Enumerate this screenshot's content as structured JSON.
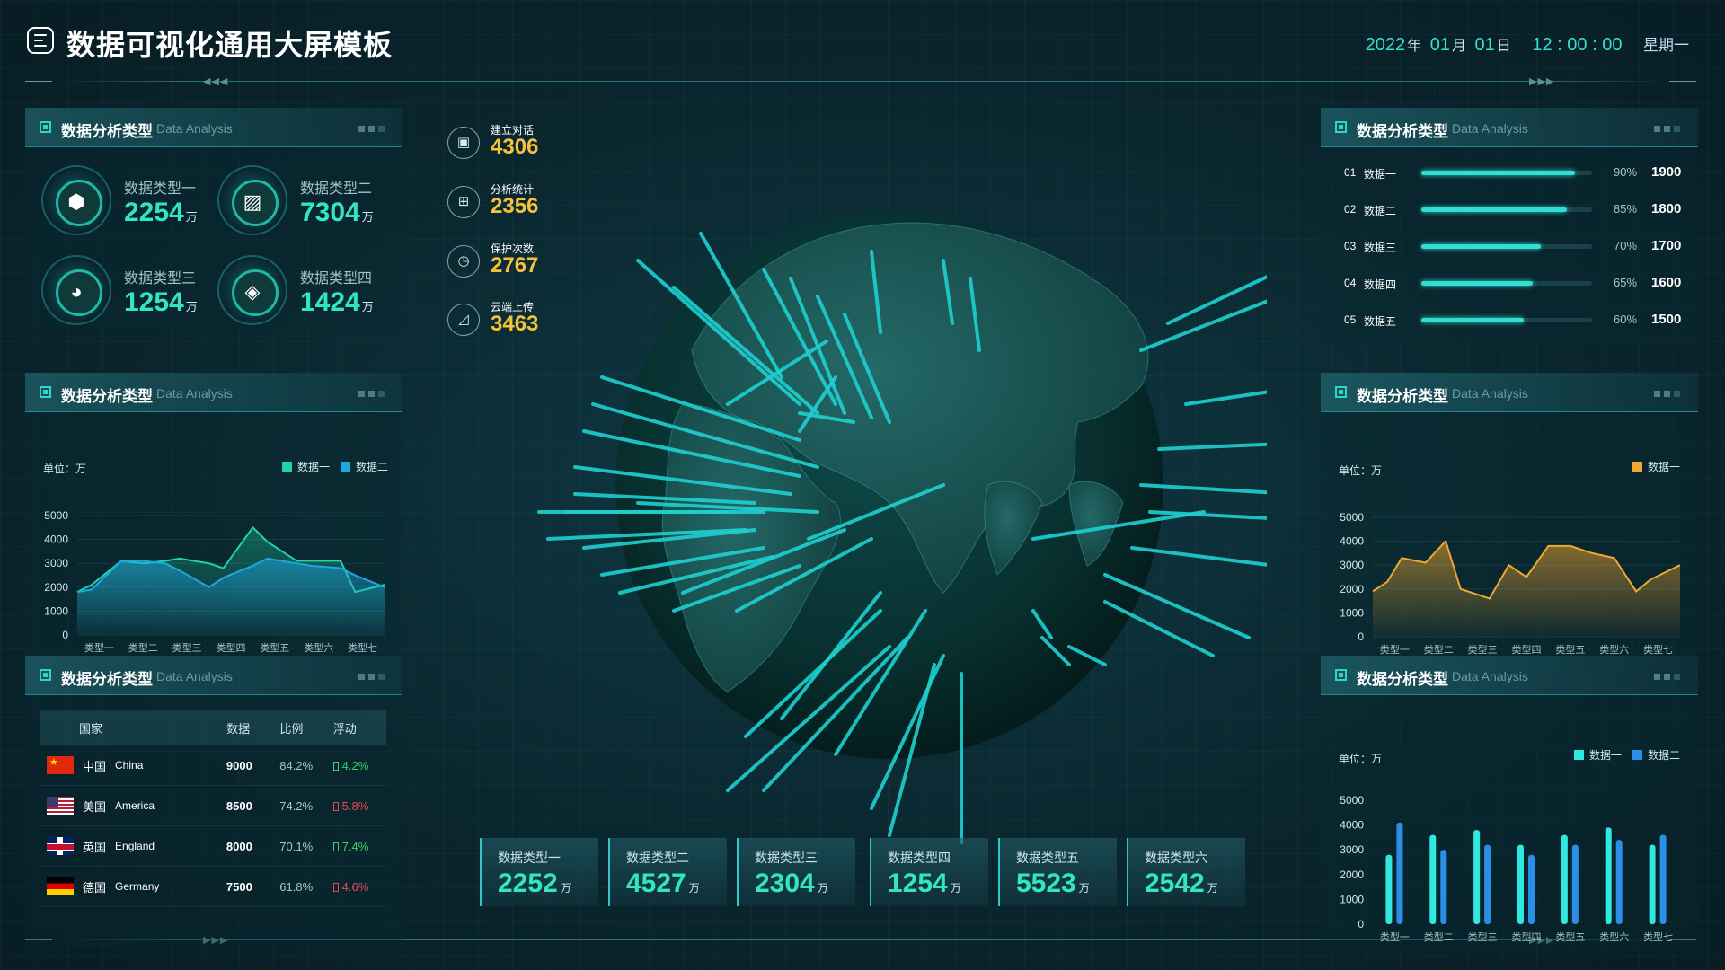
{
  "header": {
    "title": "数据可视化通用大屏模板",
    "date_year": "2022",
    "year_char": "年",
    "date_month": "01",
    "month_char": "月",
    "date_day": "01",
    "day_char": "日",
    "time": "12 : 00 : 00",
    "weekday": "星期一"
  },
  "panels": {
    "title": "数据分析类型",
    "subtitle": "Data Analysis"
  },
  "stats": [
    {
      "label": "数据类型一",
      "value": "2254",
      "unit": "万",
      "icon": "cube-icon"
    },
    {
      "label": "数据类型二",
      "value": "7304",
      "unit": "万",
      "icon": "chart-line-icon"
    },
    {
      "label": "数据类型三",
      "value": "1254",
      "unit": "万",
      "icon": "pie-chart-icon"
    },
    {
      "label": "数据类型四",
      "value": "1424",
      "unit": "万",
      "icon": "box-icon"
    }
  ],
  "left_chart": {
    "unit_label": "单位：万",
    "legend": [
      "数据一",
      "数据二"
    ]
  },
  "table": {
    "headers": [
      "国家",
      "数据",
      "比例",
      "浮动"
    ],
    "rows": [
      {
        "flag": "cn",
        "name": "中国",
        "name_en": "China",
        "data": "9000",
        "ratio": "84.2%",
        "float": "4.2%",
        "dir": "up"
      },
      {
        "flag": "us",
        "name": "美国",
        "name_en": "America",
        "data": "8500",
        "ratio": "74.2%",
        "float": "5.8%",
        "dir": "down"
      },
      {
        "flag": "uk",
        "name": "英国",
        "name_en": "England",
        "data": "8000",
        "ratio": "70.1%",
        "float": "7.4%",
        "dir": "up"
      },
      {
        "flag": "de",
        "name": "德国",
        "name_en": "Germany",
        "data": "7500",
        "ratio": "61.8%",
        "float": "4.6%",
        "dir": "down"
      }
    ]
  },
  "mini_stats": [
    {
      "label": "建立对话",
      "value": "4306",
      "icon": "monitor-icon"
    },
    {
      "label": "分析统计",
      "value": "2356",
      "icon": "chip-icon"
    },
    {
      "label": "保护次数",
      "value": "2767",
      "icon": "gauge-icon"
    },
    {
      "label": "云端上传",
      "value": "3463",
      "icon": "growth-chart-icon"
    }
  ],
  "progress": [
    {
      "index": "01",
      "name": "数据一",
      "percent": 90,
      "pct_label": "90%",
      "value": "1900"
    },
    {
      "index": "02",
      "name": "数据二",
      "percent": 85,
      "pct_label": "85%",
      "value": "1800"
    },
    {
      "index": "03",
      "name": "数据三",
      "percent": 70,
      "pct_label": "70%",
      "value": "1700"
    },
    {
      "index": "04",
      "name": "数据四",
      "percent": 65,
      "pct_label": "65%",
      "value": "1600"
    },
    {
      "index": "05",
      "name": "数据五",
      "percent": 60,
      "pct_label": "60%",
      "value": "1500"
    }
  ],
  "right_area": {
    "unit_label": "单位：万",
    "legend": [
      "数据一"
    ]
  },
  "right_bar": {
    "unit_label": "单位：万",
    "legend": [
      "数据一",
      "数据二"
    ]
  },
  "cards": [
    {
      "label": "数据类型一",
      "value": "2252",
      "unit": "万"
    },
    {
      "label": "数据类型二",
      "value": "4527",
      "unit": "万"
    },
    {
      "label": "数据类型三",
      "value": "2304",
      "unit": "万"
    },
    {
      "label": "数据类型四",
      "value": "1254",
      "unit": "万"
    },
    {
      "label": "数据类型五",
      "value": "5523",
      "unit": "万"
    },
    {
      "label": "数据类型六",
      "value": "2542",
      "unit": "万"
    }
  ],
  "colors": {
    "accent": "#2fd4c8",
    "green": "#32e6c3",
    "gold": "#f5c338",
    "series_a": "#1fd5a8",
    "series_b": "#1ea8e0",
    "bar_a": "#2fe8e0",
    "bar_b": "#2b8fe8"
  },
  "chart_data": [
    {
      "type": "area",
      "title": "数据分析类型",
      "ylabel": "单位：万",
      "categories": [
        "类型一",
        "类型二",
        "类型三",
        "类型四",
        "类型五",
        "类型六",
        "类型七"
      ],
      "ylim": [
        0,
        5000
      ],
      "yticks": [
        0,
        1000,
        2000,
        3000,
        4000,
        5000
      ],
      "x": [
        0,
        0.33,
        1,
        1.5,
        2,
        2.33,
        3,
        3.33,
        4,
        4.33,
        5,
        5.33,
        6,
        6.33,
        7
      ],
      "series": [
        {
          "name": "数据一",
          "values": [
            1800,
            2100,
            3100,
            3000,
            3100,
            3200,
            3000,
            2800,
            4500,
            3900,
            3100,
            3100,
            3100,
            1800,
            2100
          ]
        },
        {
          "name": "数据二",
          "values": [
            1800,
            1900,
            3100,
            3100,
            3000,
            2700,
            2000,
            2400,
            2900,
            3200,
            3000,
            2900,
            2800,
            2500,
            2000
          ]
        }
      ],
      "legend": "top-right",
      "grid": true
    },
    {
      "type": "area",
      "title": "数据分析类型",
      "ylabel": "单位：万",
      "categories": [
        "类型一",
        "类型二",
        "类型三",
        "类型四",
        "类型五",
        "类型六",
        "类型七"
      ],
      "ylim": [
        0,
        5000
      ],
      "yticks": [
        0,
        1000,
        2000,
        3000,
        4000,
        5000
      ],
      "x": [
        0,
        0.33,
        0.66,
        1.2,
        1.66,
        2,
        2.66,
        3.1,
        3.5,
        4,
        4.5,
        5,
        5.5,
        6,
        6.33,
        7
      ],
      "series": [
        {
          "name": "数据一",
          "values": [
            1900,
            2300,
            3300,
            3100,
            4000,
            2000,
            1600,
            3000,
            2500,
            3800,
            3800,
            3500,
            3300,
            1900,
            2400,
            3000
          ]
        }
      ],
      "legend": "top-right",
      "grid": true
    },
    {
      "type": "bar",
      "title": "数据分析类型",
      "ylabel": "单位：万",
      "categories": [
        "类型一",
        "类型二",
        "类型三",
        "类型四",
        "类型五",
        "类型六",
        "类型七"
      ],
      "ylim": [
        0,
        5000
      ],
      "yticks": [
        0,
        1000,
        2000,
        3000,
        4000,
        5000
      ],
      "series": [
        {
          "name": "数据一",
          "values": [
            2800,
            3600,
            3800,
            3200,
            3600,
            3900,
            3200
          ]
        },
        {
          "name": "数据二",
          "values": [
            4100,
            3000,
            3200,
            2800,
            3200,
            3400,
            3600
          ]
        }
      ],
      "legend": "top-right",
      "grid": false
    }
  ]
}
